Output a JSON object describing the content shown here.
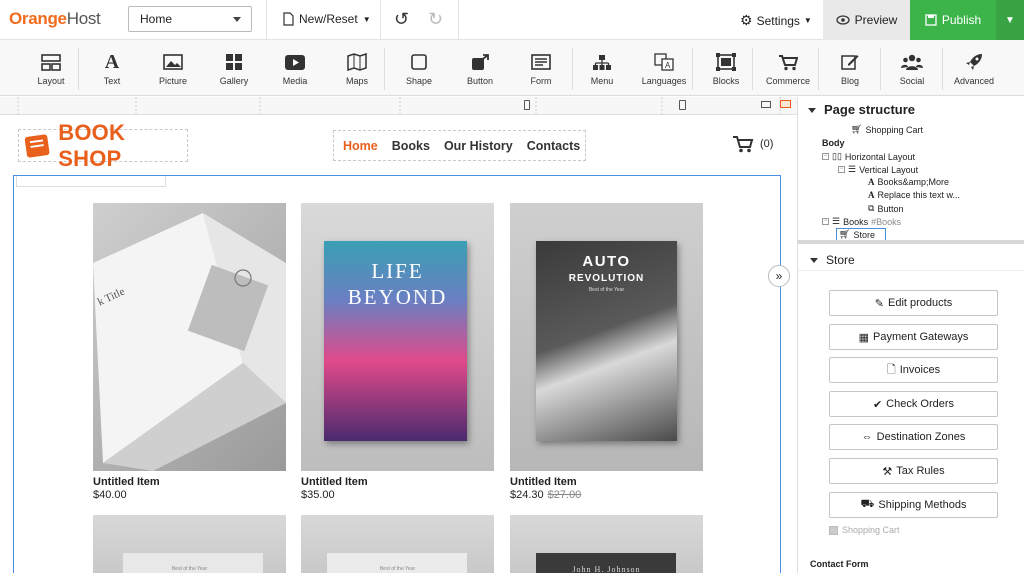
{
  "app": {
    "logo_orange": "Orange",
    "logo_host": "Host",
    "accent": "#f26b1d",
    "publish_color": "#3db44a"
  },
  "topbar": {
    "page_select": "Home",
    "new_reset": "New/Reset",
    "settings": "Settings",
    "preview": "Preview",
    "publish": "Publish"
  },
  "toolbar": {
    "tools": [
      {
        "label": "Layout",
        "icon": "layout-icon"
      },
      {
        "label": "Text",
        "icon": "text-icon"
      },
      {
        "label": "Picture",
        "icon": "picture-icon"
      },
      {
        "label": "Gallery",
        "icon": "gallery-icon"
      },
      {
        "label": "Media",
        "icon": "media-icon"
      },
      {
        "label": "Maps",
        "icon": "maps-icon"
      },
      {
        "label": "Shape",
        "icon": "shape-icon"
      },
      {
        "label": "Button",
        "icon": "button-icon"
      },
      {
        "label": "Form",
        "icon": "form-icon"
      },
      {
        "label": "Menu",
        "icon": "menu-icon"
      },
      {
        "label": "Languages",
        "icon": "languages-icon"
      },
      {
        "label": "Blocks",
        "icon": "blocks-icon"
      },
      {
        "label": "Commerce",
        "icon": "commerce-icon"
      },
      {
        "label": "Blog",
        "icon": "blog-icon"
      },
      {
        "label": "Social",
        "icon": "social-icon"
      },
      {
        "label": "Advanced",
        "icon": "advanced-icon"
      }
    ]
  },
  "site": {
    "brand": "BOOK SHOP",
    "nav": [
      "Home",
      "Books",
      "Our History",
      "Contacts"
    ],
    "cart_count": "(0)",
    "products": [
      {
        "title": "Untitled Item",
        "price": "$40.00",
        "old_price": ""
      },
      {
        "title": "Untitled Item",
        "price": "$35.00",
        "old_price": ""
      },
      {
        "title": "Untitled Item",
        "price": "$24.30",
        "old_price": "$27.00"
      }
    ],
    "book2_title_1": "LIFE",
    "book2_title_2": "BEYOND",
    "book3_title_1": "AUTO",
    "book3_title_2": "REVOLUTION",
    "book3_sub": "Best of the Year",
    "book1_text": "k Title",
    "row2_text_1": "Best of the Year",
    "row2_text_2": "Best of the Year",
    "row2_text_3": "John H. Johnson"
  },
  "panel": {
    "page_structure": "Page structure",
    "tree": {
      "shopping_cart": "Shopping Cart",
      "body": "Body",
      "horizontal": "Horizontal Layout",
      "vertical": "Vertical Layout",
      "books_more": "Books&amp;More",
      "replace": "Replace this text w...",
      "button": "Button",
      "books": "Books",
      "books_hash": "#Books",
      "store": "Store"
    },
    "store_header": "Store",
    "buttons": [
      "Edit products",
      "Payment Gateways",
      "Invoices",
      "Check Orders",
      "Destination Zones",
      "Tax Rules",
      "Shipping Methods"
    ],
    "shopping_cart_check": "Shopping Cart",
    "contact_form": "Contact Form"
  }
}
